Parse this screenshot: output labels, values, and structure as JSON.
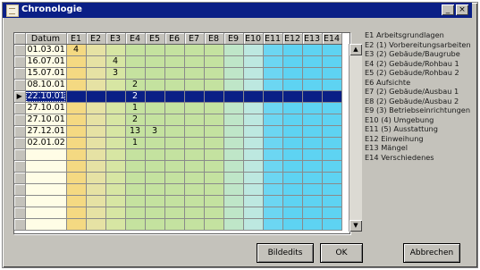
{
  "window": {
    "title": "Chronologie"
  },
  "titlebar_buttons": [
    "_",
    "×"
  ],
  "grid": {
    "date_header": "Datum",
    "columns": [
      "E1",
      "E2",
      "E3",
      "E4",
      "E5",
      "E6",
      "E7",
      "E8",
      "E9",
      "E10",
      "E11",
      "E12",
      "E13",
      "E14"
    ],
    "column_colors": [
      "#f4d982",
      "#e6e2a4",
      "#d7e6a3",
      "#c5e29f",
      "#c4e29f",
      "#c4e2a0",
      "#c4e2a0",
      "#c4e2a0",
      "#bfe6c8",
      "#bde8e0",
      "#6cd6f2",
      "#5ed3f2",
      "#5ed3f2",
      "#5ed3f2"
    ],
    "date_column_color": "#fffde6",
    "selected_row_indicator": "▶",
    "rows": [
      {
        "date": "01.03.01",
        "values": [
          "4",
          "",
          "",
          "",
          "",
          "",
          "",
          "",
          "",
          "",
          "",
          "",
          "",
          ""
        ]
      },
      {
        "date": "16.07.01",
        "values": [
          "",
          "",
          "4",
          "",
          "",
          "",
          "",
          "",
          "",
          "",
          "",
          "",
          "",
          ""
        ]
      },
      {
        "date": "15.07.01",
        "values": [
          "",
          "",
          "3",
          "",
          "",
          "",
          "",
          "",
          "",
          "",
          "",
          "",
          "",
          ""
        ]
      },
      {
        "date": "08.10.01",
        "values": [
          "",
          "",
          "",
          "2",
          "",
          "",
          "",
          "",
          "",
          "",
          "",
          "",
          "",
          ""
        ]
      },
      {
        "date": "22.10.01",
        "values": [
          "",
          "",
          "",
          "2",
          "",
          "",
          "",
          "",
          "",
          "",
          "",
          "",
          "",
          ""
        ],
        "selected": true
      },
      {
        "date": "27.10.01",
        "values": [
          "",
          "",
          "",
          "1",
          "",
          "",
          "",
          "",
          "",
          "",
          "",
          "",
          "",
          ""
        ]
      },
      {
        "date": "27.10.01",
        "values": [
          "",
          "",
          "",
          "2",
          "",
          "",
          "",
          "",
          "",
          "",
          "",
          "",
          "",
          ""
        ]
      },
      {
        "date": "27.12.01",
        "values": [
          "",
          "",
          "",
          "13",
          "3",
          "",
          "",
          "",
          "",
          "",
          "",
          "",
          "",
          ""
        ]
      },
      {
        "date": "02.01.02",
        "values": [
          "",
          "",
          "",
          "1",
          "",
          "",
          "",
          "",
          "",
          "",
          "",
          "",
          "",
          ""
        ]
      },
      {
        "date": "",
        "values": [
          "",
          "",
          "",
          "",
          "",
          "",
          "",
          "",
          "",
          "",
          "",
          "",
          "",
          ""
        ]
      },
      {
        "date": "",
        "values": [
          "",
          "",
          "",
          "",
          "",
          "",
          "",
          "",
          "",
          "",
          "",
          "",
          "",
          ""
        ]
      },
      {
        "date": "",
        "values": [
          "",
          "",
          "",
          "",
          "",
          "",
          "",
          "",
          "",
          "",
          "",
          "",
          "",
          ""
        ]
      },
      {
        "date": "",
        "values": [
          "",
          "",
          "",
          "",
          "",
          "",
          "",
          "",
          "",
          "",
          "",
          "",
          "",
          ""
        ]
      },
      {
        "date": "",
        "values": [
          "",
          "",
          "",
          "",
          "",
          "",
          "",
          "",
          "",
          "",
          "",
          "",
          "",
          ""
        ]
      },
      {
        "date": "",
        "values": [
          "",
          "",
          "",
          "",
          "",
          "",
          "",
          "",
          "",
          "",
          "",
          "",
          "",
          ""
        ]
      },
      {
        "date": "",
        "values": [
          "",
          "",
          "",
          "",
          "",
          "",
          "",
          "",
          "",
          "",
          "",
          "",
          "",
          ""
        ]
      }
    ]
  },
  "scrollbar": {
    "up": "▲",
    "down": "▼"
  },
  "legend": [
    "E1  Arbeitsgrundlagen",
    "E2  (1) Vorbereitungsarbeiten",
    "E3  (2) Gebäude/Baugrube",
    "E4  (2) Gebäude/Rohbau 1",
    "E5  (2) Gebäude/Rohbau 2",
    "E6  Aufsichte",
    "E7  (2) Gebäude/Ausbau 1",
    "E8  (2) Gebäude/Ausbau 2",
    "E9  (3) Betriebseinrichtungen",
    "E10 (4) Umgebung",
    "E11 (5) Ausstattung",
    "E12 Einweihung",
    "E13 Mängel",
    "E14 Verschiedenes"
  ],
  "buttons": {
    "bildedits": "Bildedits",
    "ok": "OK",
    "abbrechen": "Abbrechen"
  }
}
